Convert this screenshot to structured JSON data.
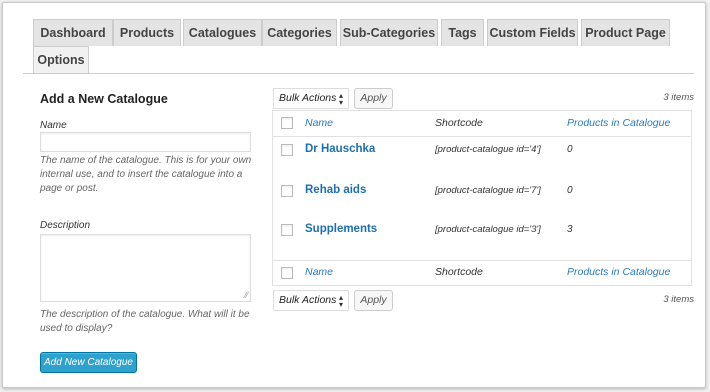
{
  "tabs": [
    {
      "label": "Dashboard"
    },
    {
      "label": "Products"
    },
    {
      "label": "Catalogues"
    },
    {
      "label": "Categories"
    },
    {
      "label": "Sub-Categories"
    },
    {
      "label": "Tags"
    },
    {
      "label": "Custom Fields"
    },
    {
      "label": "Product Page"
    },
    {
      "label": "Options"
    }
  ],
  "form": {
    "title": "Add a New Catalogue",
    "name_label": "Name",
    "name_value": "",
    "name_help": "The name of the catalogue. This is for your own internal use, and to insert the catalogue into a page or post.",
    "description_label": "Description",
    "description_value": "",
    "description_help": "The description of the catalogue. What will it be used to display?",
    "submit_label": "Add New Catalogue"
  },
  "bulk": {
    "top_select": "Bulk Actions",
    "bottom_select": "Bulk Actions",
    "apply_label": "Apply",
    "count_text": "3 items"
  },
  "table": {
    "headers": {
      "name": "Name",
      "shortcode": "Shortcode",
      "products": "Products in Catalogue"
    },
    "rows": [
      {
        "name": "Dr Hauschka",
        "shortcode": "[product-catalogue id='4']",
        "products": "0"
      },
      {
        "name": "Rehab aids",
        "shortcode": "[product-catalogue id='7']",
        "products": "0"
      },
      {
        "name": "Supplements",
        "shortcode": "[product-catalogue id='3']",
        "products": "3"
      }
    ]
  },
  "colors": {
    "primary_button": "#2ea2cc",
    "link": "#1f6fad",
    "tab_bg": "#e4e4e4"
  },
  "icons": {
    "select_arrow": "updown-arrow-icon",
    "resize": "resize-grip-icon"
  }
}
